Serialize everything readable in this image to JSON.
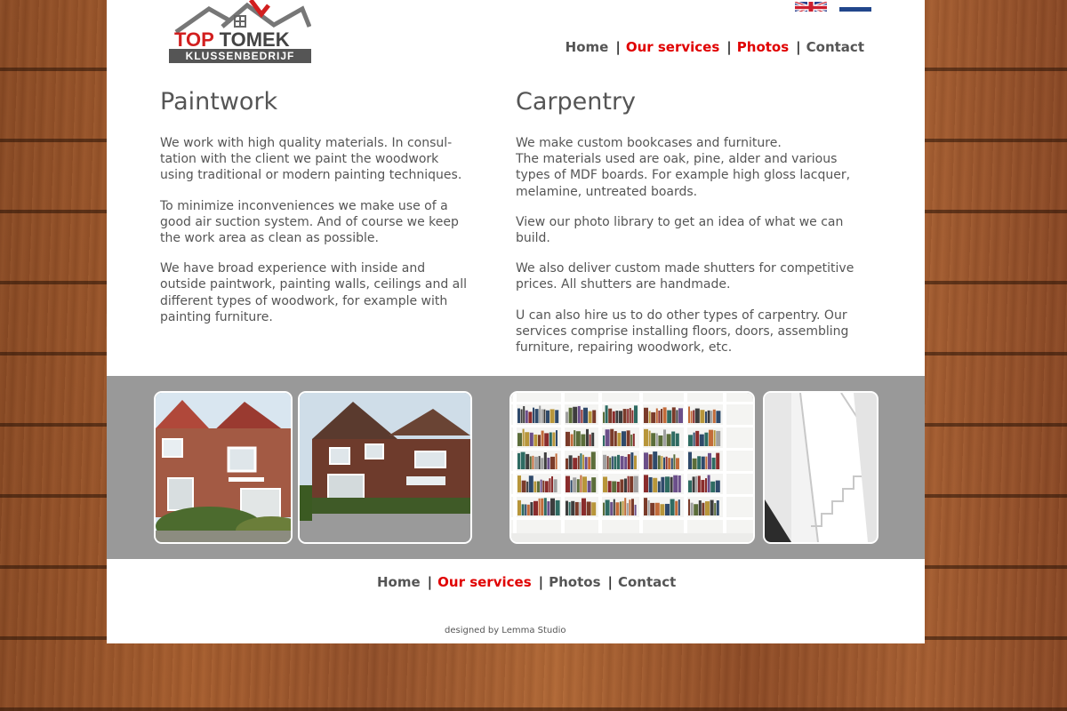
{
  "logo": {
    "word1": "TOP",
    "word2": "TOMEK",
    "tagline": "KLUSSENBEDRIJF"
  },
  "languages": [
    {
      "code": "en",
      "icon": "uk-flag-icon"
    },
    {
      "code": "nl",
      "icon": "nl-flag-icon"
    }
  ],
  "nav": {
    "items": [
      "Home",
      "Our services",
      "Photos",
      "Contact"
    ],
    "separator": "|",
    "active": "Our services",
    "top_highlighted": [
      "Our services",
      "Photos"
    ]
  },
  "colors": {
    "accent": "#e00000",
    "text": "#555555",
    "band": "#999999"
  },
  "paintwork": {
    "title": "Paintwork",
    "paragraphs": [
      "We work with high quality materials. In consul-tation with the client we paint the woodwork using traditional or modern painting techniques.",
      "To minimize inconveniences we make use of a good air suction system. And of course we keep the work area as clean as possible.",
      "We have broad experience with inside and outside paintwork, painting walls, ceilings and all different types of woodwork, for example with painting furniture."
    ]
  },
  "carpentry": {
    "title": "Carpentry",
    "intro_line1": "We make custom bookcases and furniture.",
    "intro_line2": "The materials used are oak, pine, alder and various types of MDF boards. For example high gloss lacquer, melamine, untreated boards.",
    "paragraphs": [
      "View our photo library to get an idea of what we can build.",
      "We also deliver custom made shutters for competitive prices. All shutters are handmade.",
      "U can also hire us to do other types of carpentry. Our services comprise installing floors, doors, assembling furniture, repairing woodwork, etc."
    ]
  },
  "footer": {
    "credit": "designed by Lemma Studio"
  }
}
